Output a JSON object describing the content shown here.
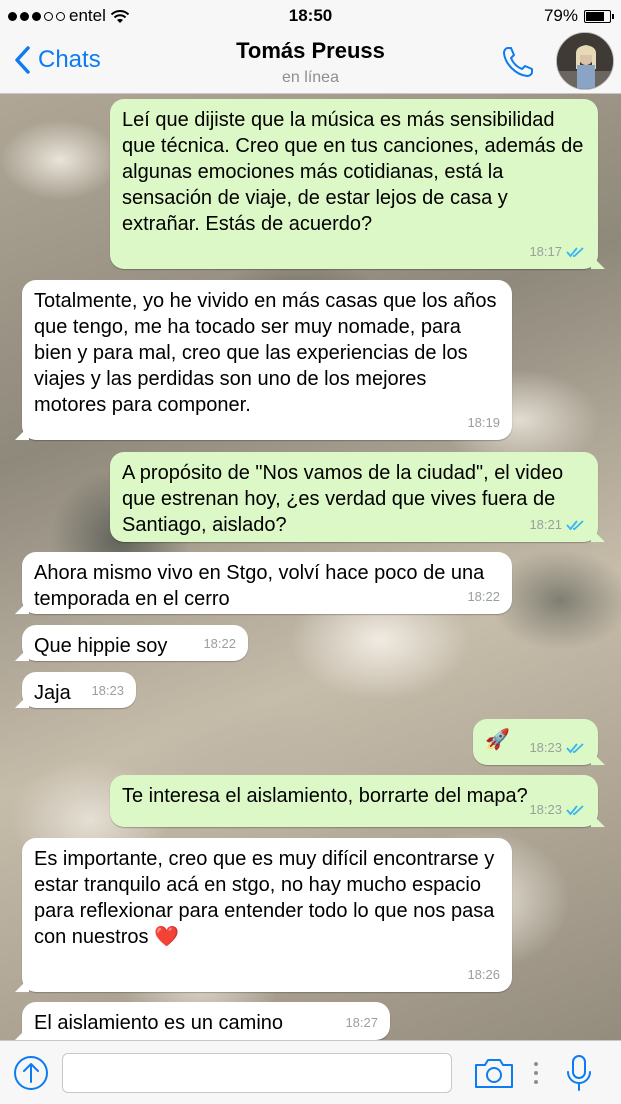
{
  "status_bar": {
    "carrier": "entel",
    "time": "18:50",
    "battery": "79%",
    "battery_level": 0.79,
    "signal_bars_filled": 3,
    "signal_bars_total": 5
  },
  "nav": {
    "back_label": "Chats",
    "contact_name": "Tomás Preuss",
    "contact_status": "en línea",
    "accent_color": "#0d7cf2"
  },
  "messages": [
    {
      "direction": "out",
      "text": "Leí que dijiste que la música es más sensibilidad que técnica. Creo que en tus canciones, además de algunas emociones más cotidianas, está la sensación de viaje, de estar lejos de casa y extrañar. Estás de acuerdo?",
      "time": "18:17",
      "read": true
    },
    {
      "direction": "in",
      "text": "Totalmente, yo he vivido en más casas que los años que tengo, me ha tocado ser muy nomade, para bien y para mal, creo que las experiencias de los viajes y las perdidas son uno de los mejores motores para componer.",
      "time": "18:19"
    },
    {
      "direction": "out",
      "text": "A propósito de \"Nos vamos de la ciudad\", el video que estrenan hoy, ¿es verdad que vives fuera de Santiago, aislado?",
      "time": "18:21",
      "read": true
    },
    {
      "direction": "in",
      "text": "Ahora mismo vivo en Stgo,  volví hace poco de una temporada en el cerro",
      "time": "18:22"
    },
    {
      "direction": "in",
      "text": "Que hippie soy",
      "time": "18:22"
    },
    {
      "direction": "in",
      "text": "Jaja",
      "time": "18:23"
    },
    {
      "direction": "out",
      "text": "🚀",
      "time": "18:23",
      "read": true
    },
    {
      "direction": "out",
      "text": "Te interesa el aislamiento, borrarte del mapa?",
      "time": "18:23",
      "read": true
    },
    {
      "direction": "in",
      "text": "Es importante, creo que es muy difícil encontrarse y estar tranquilo acá en stgo, no hay mucho espacio para reflexionar para entender todo lo que nos pasa con nuestros ❤️",
      "time": "18:26"
    },
    {
      "direction": "in",
      "text": "El aislamiento es un camino",
      "time": "18:27"
    }
  ],
  "input": {
    "placeholder": ""
  },
  "icons": {
    "back": "chevron-left-icon",
    "call": "phone-icon",
    "attach": "upload-arrow-icon",
    "camera": "camera-icon",
    "mic": "microphone-icon",
    "read_receipt": "double-check-icon"
  },
  "colors": {
    "outgoing_bubble": "#dcf8c6",
    "incoming_bubble": "#ffffff",
    "tick_blue": "#34b7f1"
  }
}
